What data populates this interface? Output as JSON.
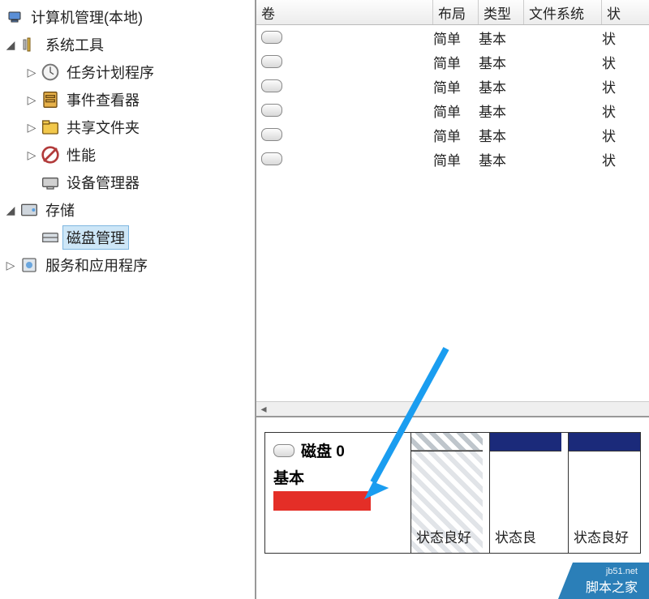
{
  "tree": {
    "root": "计算机管理(本地)",
    "system_tools": "系统工具",
    "task_scheduler": "任务计划程序",
    "event_viewer": "事件查看器",
    "shared_folders": "共享文件夹",
    "performance": "性能",
    "device_manager": "设备管理器",
    "storage": "存储",
    "disk_management": "磁盘管理",
    "services_apps": "服务和应用程序"
  },
  "volumes": {
    "headers": {
      "volume": "卷",
      "layout": "布局",
      "type": "类型",
      "fs": "文件系统",
      "status": "状"
    },
    "rows": [
      {
        "layout": "简单",
        "type": "基本",
        "fs": "",
        "status": "状"
      },
      {
        "layout": "简单",
        "type": "基本",
        "fs": "",
        "status": "状"
      },
      {
        "layout": "简单",
        "type": "基本",
        "fs": "",
        "status": "状"
      },
      {
        "layout": "简单",
        "type": "基本",
        "fs": "",
        "status": "状"
      },
      {
        "layout": "简单",
        "type": "基本",
        "fs": "",
        "status": "状"
      },
      {
        "layout": "简单",
        "type": "基本",
        "fs": "",
        "status": "状"
      }
    ]
  },
  "disk": {
    "title": "磁盘 0",
    "type": "基本",
    "partitions": [
      {
        "hatched": true,
        "strip_hatched": true,
        "status": "状态良好"
      },
      {
        "hatched": false,
        "strip_hatched": false,
        "status": "状态良"
      },
      {
        "hatched": false,
        "strip_hatched": false,
        "status": "状态良好"
      }
    ]
  },
  "watermark": {
    "url": "jb51.net",
    "name": "脚本之家"
  }
}
